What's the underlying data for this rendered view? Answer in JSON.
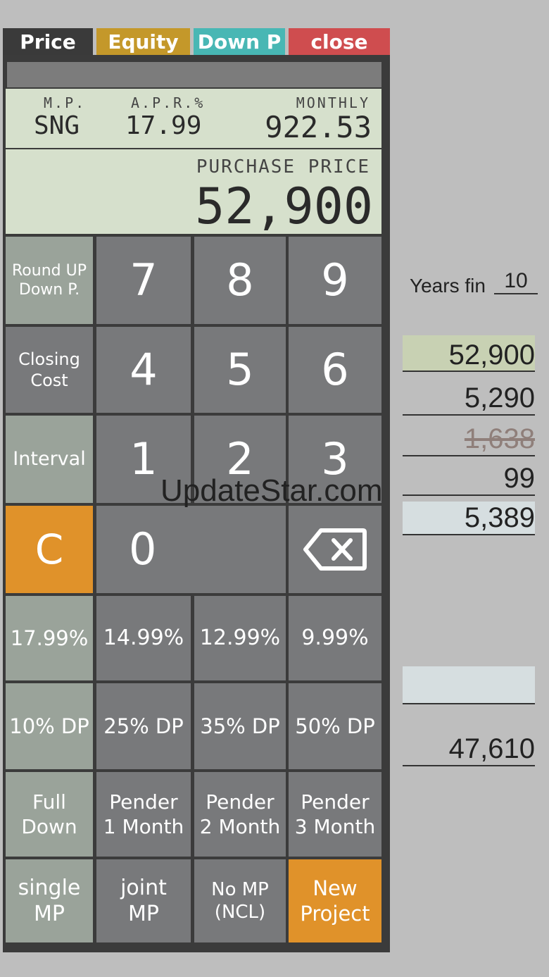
{
  "tabs": {
    "price": "Price",
    "equity": "Equity",
    "down": "Down P",
    "close": "close"
  },
  "lcd": {
    "mp_label": "M.P.",
    "mp_value": "SNG",
    "apr_label": "A.P.R.%",
    "apr_value": "17.99",
    "monthly_label": "MONTHLY",
    "monthly_value": "922.53",
    "purchase_label": "PURCHASE PRICE",
    "purchase_value": "52,900"
  },
  "keys": {
    "round_line1": "Round UP",
    "round_line2": "Down P.",
    "closing_line1": "Closing",
    "closing_line2": "Cost",
    "interval": "Interval",
    "clear": "C",
    "n7": "7",
    "n8": "8",
    "n9": "9",
    "n4": "4",
    "n5": "5",
    "n6": "6",
    "n1": "1",
    "n2": "2",
    "n3": "3",
    "n0": "0",
    "rate1": "17.99%",
    "rate2": "14.99%",
    "rate3": "12.99%",
    "rate4": "9.99%",
    "dp1": "10% DP",
    "dp2": "25% DP",
    "dp3": "35% DP",
    "dp4": "50% DP",
    "full_line1": "Full",
    "full_line2": "Down",
    "pender1_line1": "Pender",
    "pender1_line2": "1 Month",
    "pender2_line1": "Pender",
    "pender2_line2": "2 Month",
    "pender3_line1": "Pender",
    "pender3_line2": "3 Month",
    "single_line1": "single",
    "single_line2": "MP",
    "joint_line1": "joint",
    "joint_line2": "MP",
    "nomp_line1": "No MP",
    "nomp_line2": "(NCL)",
    "new_line1": "New",
    "new_line2": "Project"
  },
  "right": {
    "years_label": "Years fin",
    "years_value": "10",
    "price": "52,900",
    "down": "5,290",
    "closing": "1,638",
    "extra": "99",
    "total_down": "5,389",
    "blank": "",
    "financed": "47,610"
  },
  "watermark": "UpdateStar.com",
  "colors": {
    "equity": "#c4982a",
    "down": "#48b7b4",
    "close": "#cf4d4f",
    "orange": "#e0922a",
    "lcd": "#d6e0cc"
  }
}
